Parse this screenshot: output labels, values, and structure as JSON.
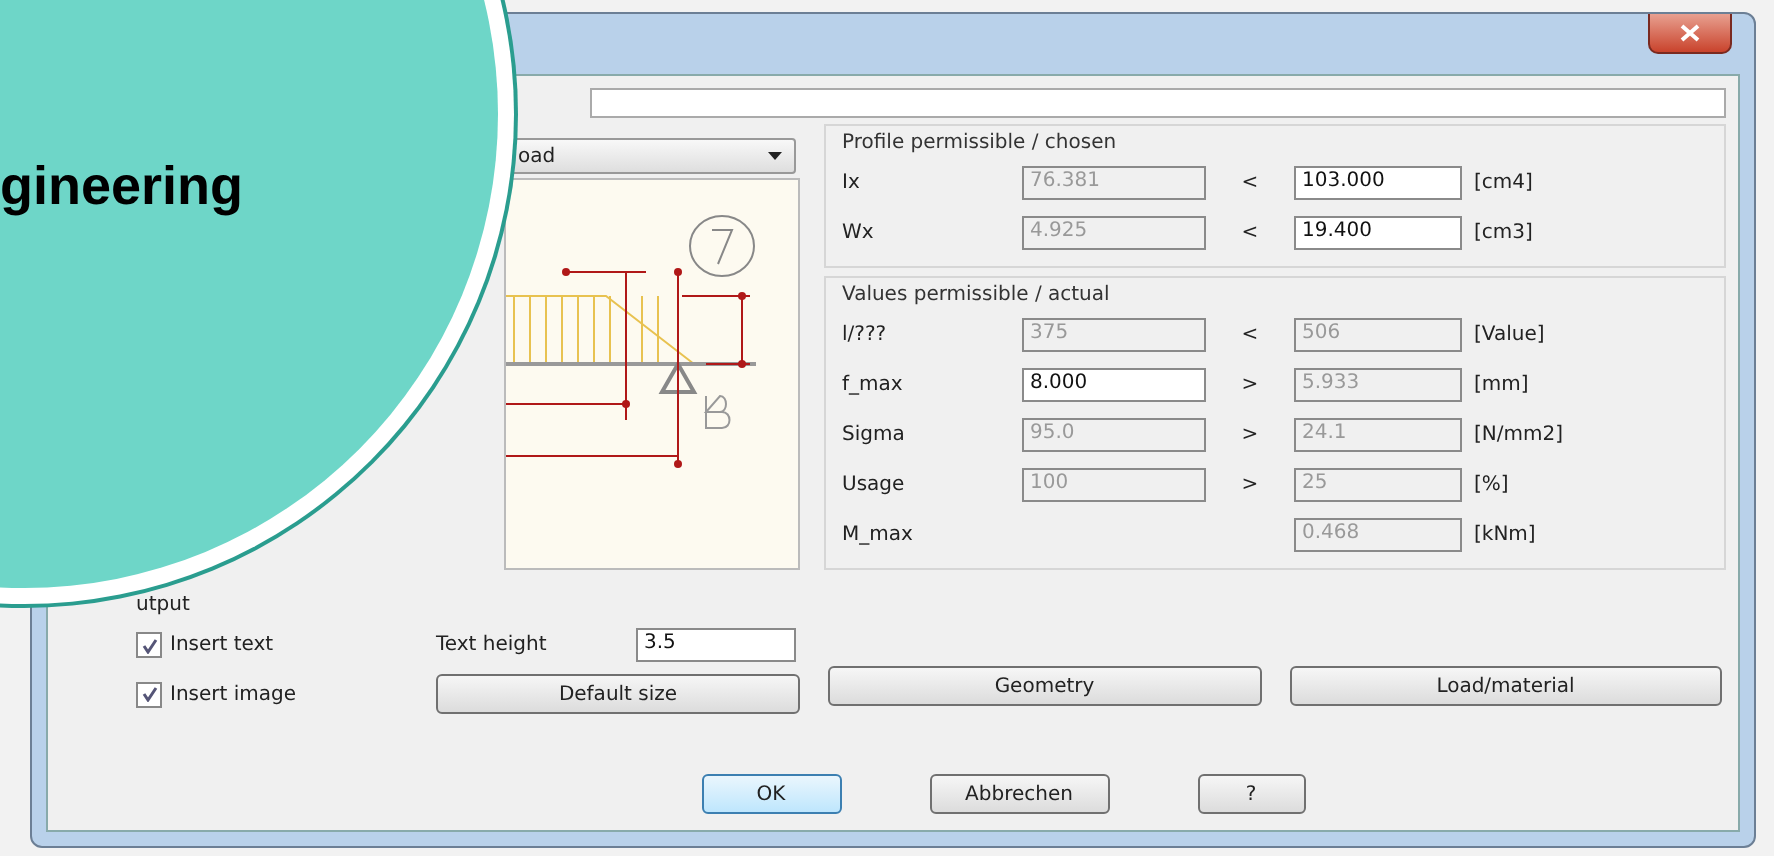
{
  "banner": {
    "text": "gineering"
  },
  "load_type": {
    "value": "oad"
  },
  "output": {
    "label": "utput",
    "options": [
      {
        "label": "Insert text",
        "checked": true
      },
      {
        "label": "Insert image",
        "checked": true
      }
    ],
    "text_height": {
      "label": "Text height",
      "value": "3.5"
    },
    "default_button": "Default size"
  },
  "profile": {
    "title": "Profile permissible / chosen",
    "rows": [
      {
        "label": "Ix",
        "permissible": {
          "value": "76.381",
          "disabled": true
        },
        "relation": "<",
        "chosen": {
          "value": "103.000",
          "disabled": false
        },
        "unit": "[cm4]"
      },
      {
        "label": "Wx",
        "permissible": {
          "value": "4.925",
          "disabled": true
        },
        "relation": "<",
        "chosen": {
          "value": "19.400",
          "disabled": false
        },
        "unit": "[cm3]"
      }
    ]
  },
  "values": {
    "title": "Values  permissible / actual",
    "rows": [
      {
        "label": "l/???",
        "permissible": {
          "value": "375",
          "disabled": true
        },
        "relation": "<",
        "actual": {
          "value": "506",
          "disabled": true
        },
        "unit": "[Value]"
      },
      {
        "label": "f_max",
        "permissible": {
          "value": "8.000",
          "disabled": false
        },
        "relation": ">",
        "actual": {
          "value": "5.933",
          "disabled": true
        },
        "unit": "[mm]"
      },
      {
        "label": "Sigma",
        "permissible": {
          "value": "95.0",
          "disabled": true
        },
        "relation": ">",
        "actual": {
          "value": "24.1",
          "disabled": true
        },
        "unit": "[N/mm2]"
      },
      {
        "label": "Usage",
        "permissible": {
          "value": "100",
          "disabled": true
        },
        "relation": ">",
        "actual": {
          "value": "25",
          "disabled": true
        },
        "unit": "[%]"
      },
      {
        "label": "M_max",
        "actual": {
          "value": "0.468",
          "disabled": true
        },
        "unit": "[kNm]"
      }
    ]
  },
  "action_buttons": [
    "Geometry",
    "Load/material"
  ],
  "footer_buttons": [
    {
      "label": "OK",
      "default": true
    },
    {
      "label": "Abbrechen",
      "default": false
    },
    {
      "label": "?",
      "default": false
    }
  ]
}
